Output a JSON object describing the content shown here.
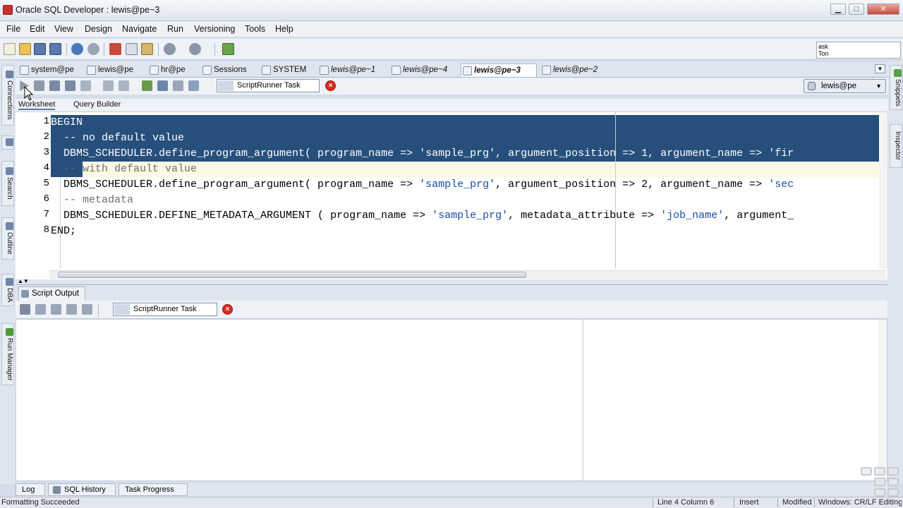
{
  "window": {
    "title": "Oracle SQL Developer : lewis@pe~3",
    "minimize": "▁",
    "maximize": "□",
    "close": "✕"
  },
  "menu": [
    "File",
    "Edit",
    "View",
    "Design",
    "Navigate",
    "Run",
    "Versioning",
    "Tools",
    "Help"
  ],
  "task_box": {
    "line1": "ask",
    "line2": "Ton"
  },
  "left_panels": [
    "Connections",
    "Search",
    "Outline",
    "DBA",
    "Run Manager"
  ],
  "right_panels": [
    "Snippets",
    "Inspector"
  ],
  "editor_tabs": [
    "system@pe",
    "lewis@pe",
    "hr@pe",
    "Sessions",
    "SYSTEM",
    "lewis@pe~1",
    "lewis@pe~4",
    "lewis@pe~3",
    "lewis@pe~2"
  ],
  "active_tab": "lewis@pe~3",
  "worksheet_toolbar": {
    "task_label": "ScriptRunner Task",
    "connection": "lewis@pe"
  },
  "sub_tabs": [
    "Worksheet",
    "Query Builder"
  ],
  "code": {
    "line_numbers": [
      "1",
      "2",
      "3",
      "4",
      "5",
      "6",
      "7",
      "8"
    ],
    "l1": "BEGIN",
    "l2": "  -- no default value",
    "l3a": "  DBMS_SCHEDULER.define_program_argument( program_name => ",
    "l3b": "'sample_prg'",
    "l3c": ", argument_position => 1, argument_name => ",
    "l3d": "'fir",
    "l4a": "  -- ",
    "l4b": "with default value",
    "l5a": "  DBMS_SCHEDULER.define_program_argument( program_name => ",
    "l5b": "'sample_prg'",
    "l5c": ", argument_position => 2, argument_name => ",
    "l5d": "'sec",
    "l6": "  -- metadata",
    "l7a": "  DBMS_SCHEDULER.DEFINE_METADATA_ARGUMENT ( program_name => ",
    "l7b": "'sample_prg'",
    "l7c": ", metadata_attribute => ",
    "l7d": "'job_name'",
    "l7e": ", argument_",
    "l8": "END;"
  },
  "output": {
    "tab": "Script Output",
    "task_label": "ScriptRunner Task"
  },
  "bottom_tabs": [
    "Log",
    "SQL History",
    "Task Progress"
  ],
  "status": {
    "message": "Formatting Succeeded",
    "position": "Line 4 Column 6",
    "mode": "Insert",
    "modified": "Modified",
    "encoding": "Windows: CR/LF Editing"
  }
}
